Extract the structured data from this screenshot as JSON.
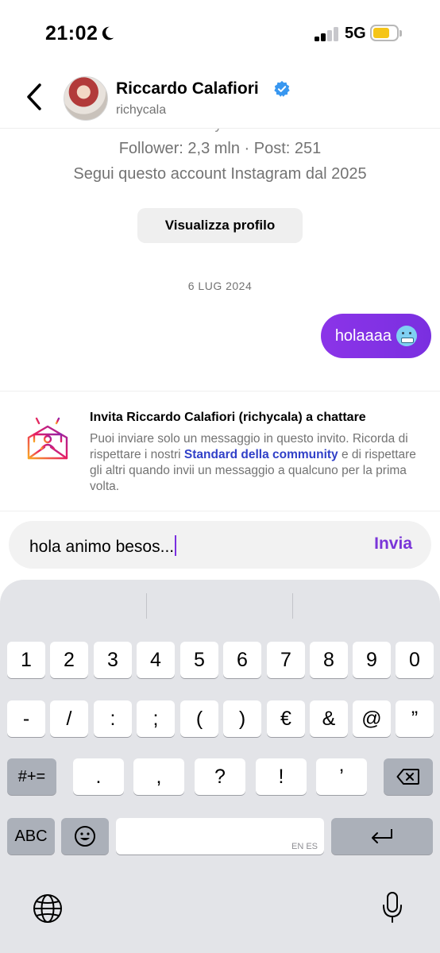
{
  "status_bar": {
    "time": "21:02",
    "network": "5G",
    "icons": [
      "moon-icon",
      "signal-icon",
      "battery-icon"
    ]
  },
  "header": {
    "name": "Riccardo Calafiori",
    "handle": "richycala",
    "icons": [
      "back-arrow-icon",
      "verified-badge-icon"
    ]
  },
  "profile": {
    "cut_handle": "richycala",
    "stats": "Follower: 2,3 mln · Post: 251",
    "follow_since": "Segui questo account Instagram dal 2025",
    "view_button": "Visualizza profilo"
  },
  "thread": {
    "date": "6 LUG 2024",
    "message": "holaaaa",
    "message_emoji": "cold-face-emoji"
  },
  "invite": {
    "title": "Invita Riccardo Calafiori (richycala) a chattare",
    "text_before": "Puoi inviare solo un messaggio in questo invito. Ricorda di rispettare i nostri ",
    "link": "Standard della community",
    "text_after": " e di rispettare gli altri quando invii un messaggio a qualcuno per la prima volta.",
    "icon": "invite-envelope-icon"
  },
  "composer": {
    "value": "hola animo besos...",
    "send": "Invia"
  },
  "keyboard": {
    "row1": [
      "1",
      "2",
      "3",
      "4",
      "5",
      "6",
      "7",
      "8",
      "9",
      "0"
    ],
    "row2": [
      "-",
      "/",
      ":",
      ";",
      "(",
      ")",
      "€",
      "&",
      "@",
      "”"
    ],
    "row3_toggle": "#+=",
    "row3": [
      ".",
      ",",
      "?",
      "!",
      "’"
    ],
    "abc": "ABC",
    "space_languages": "EN ES",
    "icons": [
      "delete-icon",
      "emoji-icon",
      "return-icon",
      "globe-icon",
      "microphone-icon"
    ]
  },
  "colors": {
    "accent": "#7a35d8",
    "bubble": "#8b34e8",
    "link": "#3040c8",
    "battery": "#f5c518"
  }
}
